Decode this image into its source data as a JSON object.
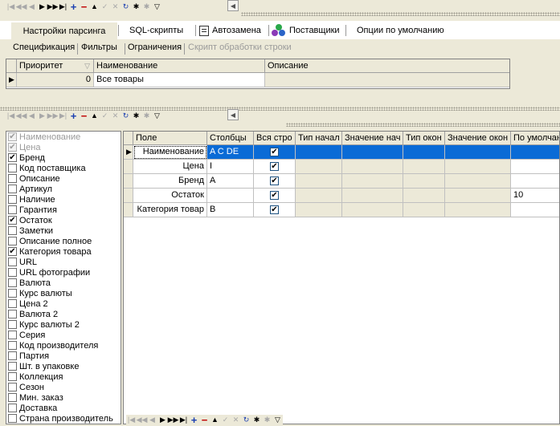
{
  "tabs": {
    "parsing_settings": "Настройки парсинга",
    "sql_scripts": "SQL-скрипты",
    "autoreplace": "Автозамена",
    "suppliers": "Поставщики",
    "default_options": "Опции по умолчанию"
  },
  "subtabs": {
    "specification": "Спецификация",
    "filters": "Фильтры",
    "restrictions": "Ограничения",
    "row_script": "Скрипт обработки строки"
  },
  "top_grid": {
    "columns": [
      "Приоритет",
      "Наименование",
      "Описание"
    ],
    "rows": [
      {
        "priority": "0",
        "name": "Все товары",
        "description": ""
      }
    ]
  },
  "field_list": [
    {
      "label": "Наименование",
      "checked": true,
      "disabled": true
    },
    {
      "label": "Цена",
      "checked": true,
      "disabled": true
    },
    {
      "label": "Бренд",
      "checked": true,
      "disabled": false
    },
    {
      "label": "Код поставщика",
      "checked": false,
      "disabled": false
    },
    {
      "label": "Описание",
      "checked": false,
      "disabled": false
    },
    {
      "label": "Артикул",
      "checked": false,
      "disabled": false
    },
    {
      "label": "Наличие",
      "checked": false,
      "disabled": false
    },
    {
      "label": "Гарантия",
      "checked": false,
      "disabled": false
    },
    {
      "label": "Остаток",
      "checked": true,
      "disabled": false
    },
    {
      "label": "Заметки",
      "checked": false,
      "disabled": false
    },
    {
      "label": "Описание полное",
      "checked": false,
      "disabled": false
    },
    {
      "label": "Категория товара",
      "checked": true,
      "disabled": false
    },
    {
      "label": "URL",
      "checked": false,
      "disabled": false
    },
    {
      "label": "URL фотографии",
      "checked": false,
      "disabled": false
    },
    {
      "label": "Валюта",
      "checked": false,
      "disabled": false
    },
    {
      "label": "Курс валюты",
      "checked": false,
      "disabled": false
    },
    {
      "label": "Цена 2",
      "checked": false,
      "disabled": false
    },
    {
      "label": "Валюта 2",
      "checked": false,
      "disabled": false
    },
    {
      "label": "Курс валюты 2",
      "checked": false,
      "disabled": false
    },
    {
      "label": "Серия",
      "checked": false,
      "disabled": false
    },
    {
      "label": "Код производителя",
      "checked": false,
      "disabled": false
    },
    {
      "label": "Партия",
      "checked": false,
      "disabled": false
    },
    {
      "label": "Шт. в упаковке",
      "checked": false,
      "disabled": false
    },
    {
      "label": "Коллекция",
      "checked": false,
      "disabled": false
    },
    {
      "label": "Сезон",
      "checked": false,
      "disabled": false
    },
    {
      "label": "Мин. заказ",
      "checked": false,
      "disabled": false
    },
    {
      "label": "Доставка",
      "checked": false,
      "disabled": false
    },
    {
      "label": "Страна производитель",
      "checked": false,
      "disabled": false
    }
  ],
  "main_grid": {
    "columns": [
      "Поле",
      "Столбцы",
      "Вся стро",
      "Тип начал",
      "Значение нач",
      "Тип окон",
      "Значение окон",
      "По умолчан"
    ],
    "rows": [
      {
        "field": "Наименование",
        "columns": "A C DE",
        "whole_row": true,
        "default": ""
      },
      {
        "field": "Цена",
        "columns": "I",
        "whole_row": true,
        "default": ""
      },
      {
        "field": "Бренд",
        "columns": "A",
        "whole_row": true,
        "default": ""
      },
      {
        "field": "Остаток",
        "columns": "",
        "whole_row": true,
        "default": "10"
      },
      {
        "field": "Категория товар",
        "columns": "B",
        "whole_row": true,
        "default": ""
      }
    ]
  },
  "icons": {
    "nav": [
      "first-icon",
      "prev-page-icon",
      "prev-icon",
      "next-icon",
      "next-page-icon",
      "last-icon",
      "add-icon",
      "delete-icon",
      "move-up-icon",
      "post-icon",
      "cancel-icon",
      "refresh-icon",
      "star-icon",
      "asterisk-icon",
      "filter-icon"
    ]
  }
}
